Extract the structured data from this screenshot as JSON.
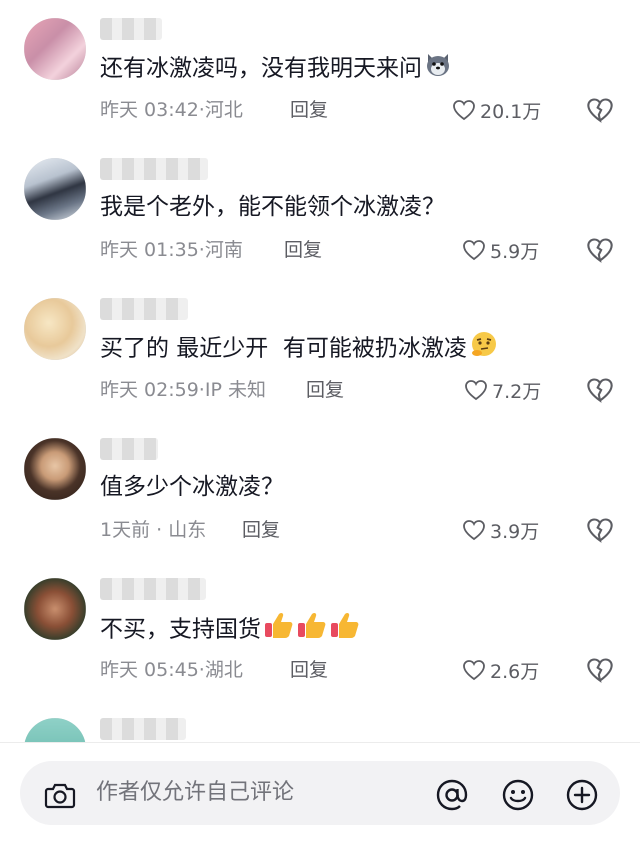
{
  "comments": [
    {
      "text": "还有冰激凌吗，没有我明天来问",
      "emoji": "wolf-emoji",
      "time": "昨天 03:42",
      "location": "河北",
      "reply": "回复",
      "likes": "20.1万"
    },
    {
      "text": "我是个老外，能不能领个冰激凌？",
      "emoji": "",
      "time": "昨天 01:35",
      "location": "河南",
      "reply": "回复",
      "likes": "5.9万"
    },
    {
      "text": "买了的 最近少开  有可能被扔冰激凌",
      "emoji": "thinking-emoji",
      "time": "昨天 02:59",
      "location": "IP 未知",
      "reply": "回复",
      "likes": "7.2万"
    },
    {
      "text": "值多少个冰激凌？",
      "emoji": "",
      "time": "1天前",
      "location": "山东",
      "reply": "回复",
      "likes": "3.9万"
    },
    {
      "text": "不买，支持国货",
      "emoji": "thumbs-up-x3",
      "time": "昨天 05:45",
      "location": "湖北",
      "reply": "回复",
      "likes": "2.6万"
    }
  ],
  "bottom_bar": {
    "placeholder": "作者仅允许自己评论"
  },
  "colors": {
    "text": "#161823",
    "meta": "#8a8b91",
    "thumb": "#f5a623",
    "heart": "#5c5d63"
  }
}
